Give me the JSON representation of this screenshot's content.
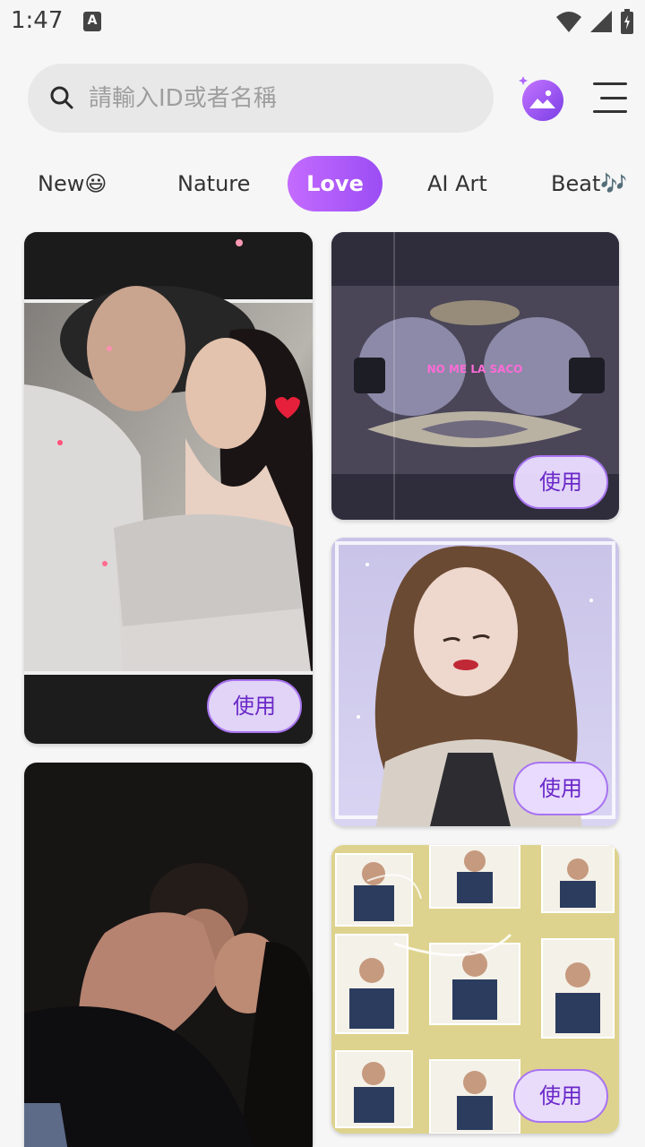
{
  "status_bar": {
    "time": "1:47",
    "notification_icon": "a-icon",
    "indicator_icons": [
      "wifi-icon",
      "cell-signal-icon",
      "battery-icon"
    ]
  },
  "search": {
    "placeholder": "請輸入ID或者名稱",
    "icon": "search-icon"
  },
  "header": {
    "ai_photo_icon": "photo-sparkle-icon",
    "menu_icon": "menu-icon"
  },
  "tabs": [
    {
      "label": "New😃",
      "active": false
    },
    {
      "label": "Nature",
      "active": false
    },
    {
      "label": "Love",
      "active": true
    },
    {
      "label": "AI Art",
      "active": false
    },
    {
      "label": "Beat🎶",
      "active": false
    }
  ],
  "cards": [
    {
      "use_label": "使用"
    },
    {
      "use_label": "使用"
    },
    {
      "use_label": "使用"
    },
    {
      "use_label": "使用"
    },
    {
      "neon_text": "NO ME LA SACO"
    }
  ],
  "colors": {
    "accent_start": "#c46bff",
    "accent_end": "#9b4df4",
    "use_button_bg": "#e9dcff",
    "use_button_text": "#6a28c8"
  }
}
